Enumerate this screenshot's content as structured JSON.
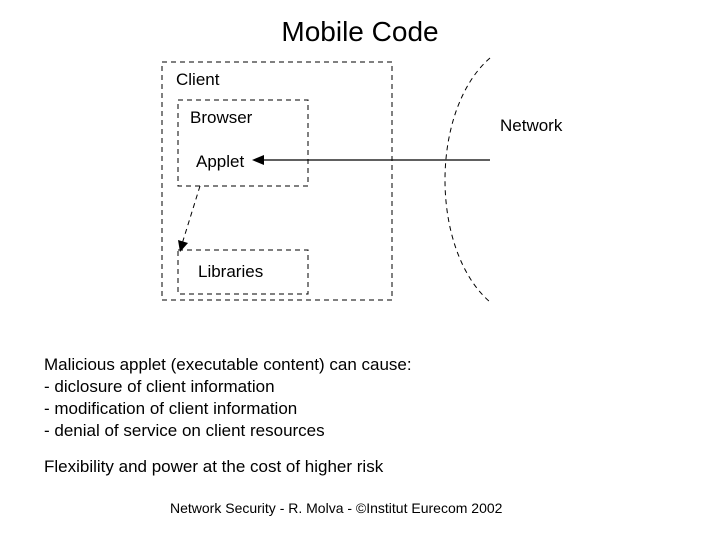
{
  "title": "Mobile Code",
  "labels": {
    "client": "Client",
    "browser": "Browser",
    "applet": "Applet",
    "network": "Network",
    "libraries": "Libraries"
  },
  "body": {
    "line1": "Malicious applet (executable content) can cause:",
    "line2": "- diclosure of client information",
    "line3": "- modification of client information",
    "line4": "- denial of service on client resources",
    "line5": "Flexibility and power at the cost of higher risk"
  },
  "footer": "Network Security - R. Molva - ©Institut Eurecom 2002"
}
